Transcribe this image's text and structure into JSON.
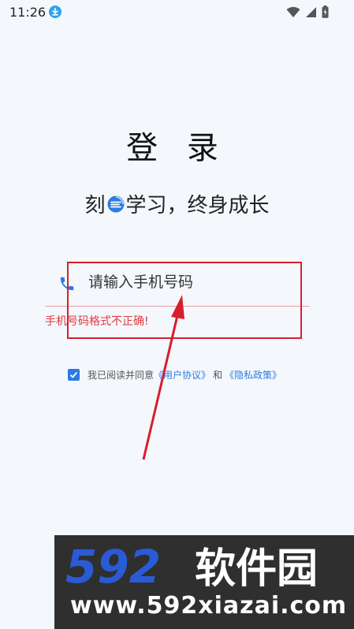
{
  "status_bar": {
    "time": "11:26",
    "icons": [
      "download-icon",
      "wifi-icon",
      "signal-icon",
      "battery-icon"
    ]
  },
  "login": {
    "title": "登 录",
    "slogan_before": "刻",
    "slogan_logo": "logo-icon",
    "slogan_after": "学习，终身成长",
    "phone_placeholder": "请输入手机号码",
    "phone_value": "",
    "error_message": "手机号码格式不正确!",
    "agreement": {
      "checked": true,
      "prefix": "我已阅读并同意",
      "user_agreement": "《用户协议》",
      "conjunction": "和",
      "privacy_policy": "《隐私政策》"
    }
  },
  "watermark": {
    "brand_digits": "592",
    "brand_name": "软件园",
    "url": "www.592xiazai.com"
  },
  "colors": {
    "background": "#f4f8fd",
    "accent": "#2c7be5",
    "error": "#e0393e",
    "annotation": "#d81e2c",
    "watermark_bg": "#2f2f2f",
    "watermark_digits": "#2a5bd7"
  }
}
